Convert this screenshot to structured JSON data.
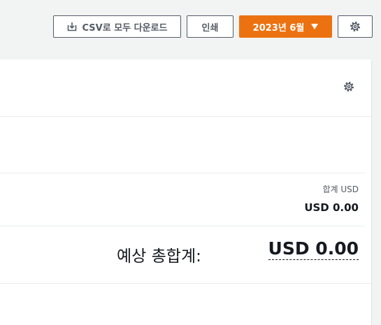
{
  "toolbar": {
    "download_csv_label": "CSV로 모두 다운로드",
    "print_label": "인쇄",
    "month_selector_label": "2023년 6월",
    "accent_color": "#ec7211"
  },
  "icons": {
    "download": "download-icon",
    "caret": "caret-down-icon",
    "settings": "gear-icon"
  },
  "summary": {
    "column_header": "합계 USD",
    "subtotal_value": "USD 0.00",
    "estimated_total_label": "예상 총합계:",
    "estimated_total_value": "USD 0.00"
  }
}
